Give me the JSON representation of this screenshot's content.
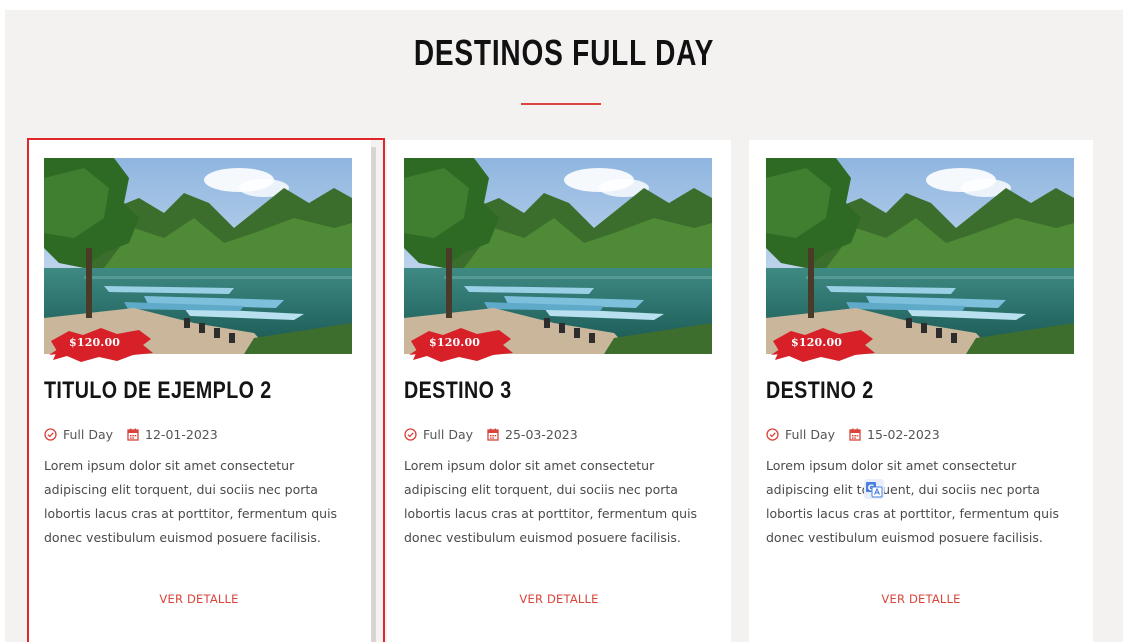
{
  "section": {
    "title": "DESTINOS FULL DAY"
  },
  "cards": [
    {
      "price": "$120.00",
      "title": "TITULO DE EJEMPLO 2",
      "category": "Full Day",
      "date": "12-01-2023",
      "description": "Lorem ipsum dolor sit amet consectetur adipiscing elit torquent, dui sociis nec porta lobortis lacus cras at porttitor, fermentum quis donec vestibulum euismod posuere facilisis.",
      "link_label": "VER DETALLE"
    },
    {
      "price": "$120.00",
      "title": "DESTINO 3",
      "category": "Full Day",
      "date": "25-03-2023",
      "description": "Lorem ipsum dolor sit amet consectetur adipiscing elit torquent, dui sociis nec porta lobortis lacus cras at porttitor, fermentum quis donec vestibulum euismod posuere facilisis.",
      "link_label": "VER DETALLE"
    },
    {
      "price": "$120.00",
      "title": "DESTINO 2",
      "category": "Full Day",
      "date": "15-02-2023",
      "description": "Lorem ipsum dolor sit amet consectetur adipiscing elit torquent, dui sociis nec porta lobortis lacus cras at porttitor, fermentum quis donec vestibulum euismod posuere facilisis.",
      "link_label": "VER DETALLE"
    }
  ],
  "colors": {
    "accent": "#d9443b",
    "selection": "#e2242b",
    "background": "#f4f1f1"
  },
  "icons": {
    "category": "check-circle-icon",
    "date": "calendar-icon",
    "overlay": "translate-icon"
  }
}
